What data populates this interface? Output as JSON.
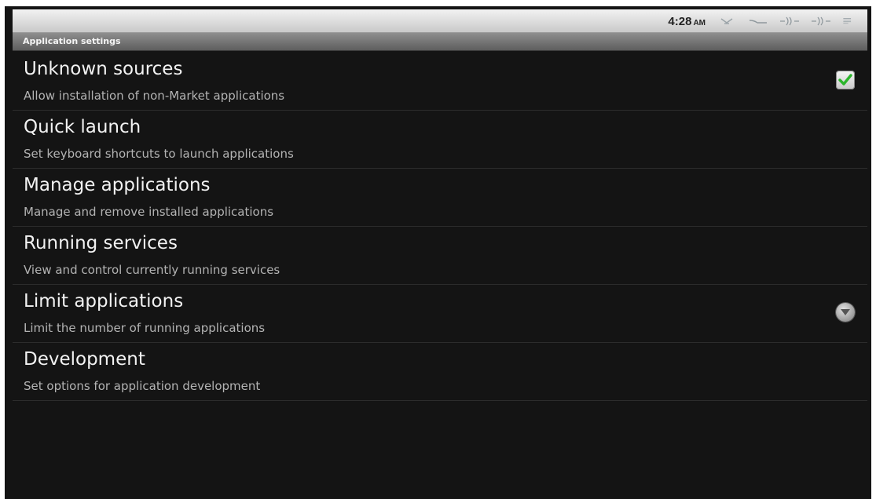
{
  "status_bar": {
    "time": "4:28",
    "ampm": "AM",
    "icons": [
      "usb-icon",
      "signal-icon",
      "wifi-icon",
      "wifi-icon",
      "notification-icon"
    ]
  },
  "title_bar": {
    "title": "Application settings"
  },
  "settings": {
    "items": [
      {
        "title": "Unknown sources",
        "summary": "Allow installation of non-Market applications",
        "widget": "checkbox",
        "checked": true
      },
      {
        "title": "Quick launch",
        "summary": "Set keyboard shortcuts to launch applications"
      },
      {
        "title": "Manage applications",
        "summary": "Manage and remove installed applications"
      },
      {
        "title": "Running services",
        "summary": "View and control currently running services"
      },
      {
        "title": "Limit applications",
        "summary": "Limit the number of running applications",
        "widget": "dropdown"
      },
      {
        "title": "Development",
        "summary": "Set options for application development"
      }
    ]
  },
  "colors": {
    "background": "#141414",
    "title_text": "#f2f2f2",
    "summary_text": "#b3b3b3",
    "check_green": "#2bb52b"
  }
}
